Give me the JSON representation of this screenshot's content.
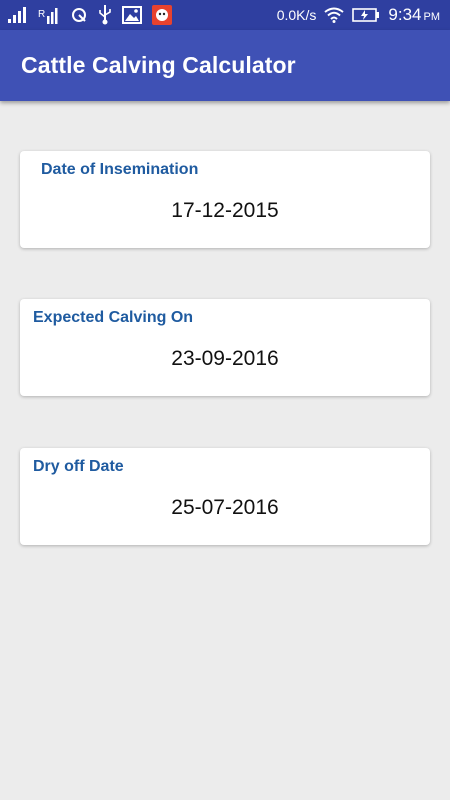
{
  "status_bar": {
    "icons_left": [
      "signal-bars-icon",
      "signal-rii-icon",
      "sync-icon",
      "usb-icon",
      "image-icon",
      "app-notification-icon"
    ],
    "net_speed": "0.0K/s",
    "time": "9:34",
    "ampm": "PM",
    "icons_right": [
      "wifi-icon",
      "battery-icon"
    ]
  },
  "app_bar": {
    "title": "Cattle Calving Calculator",
    "color": "#3f51b5"
  },
  "cards": [
    {
      "label": "Date of Insemination",
      "value": "17-12-2015"
    },
    {
      "label": "Expected Calving On",
      "value": "23-09-2016"
    },
    {
      "label": "Dry off Date",
      "value": "25-07-2016"
    }
  ],
  "colors": {
    "label": "#1f5ba0",
    "background": "#ececec"
  }
}
